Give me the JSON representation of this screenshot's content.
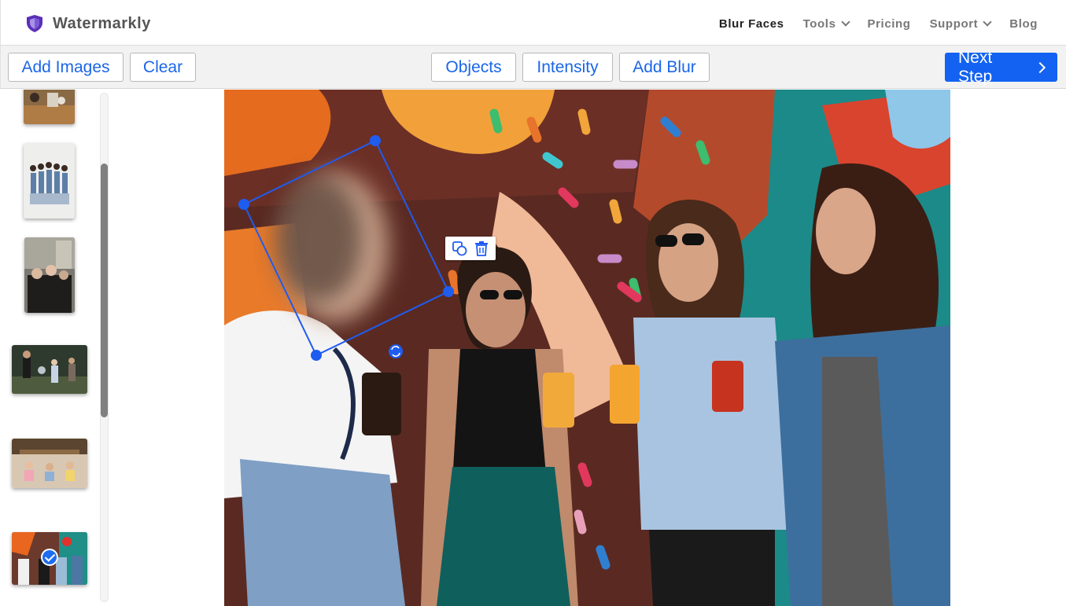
{
  "app": {
    "name": "Watermarkly",
    "brand_color": "#5b2fb8"
  },
  "nav": {
    "items": [
      {
        "label": "Blur Faces",
        "active": true,
        "dropdown": false
      },
      {
        "label": "Tools",
        "active": false,
        "dropdown": true
      },
      {
        "label": "Pricing",
        "active": false,
        "dropdown": false
      },
      {
        "label": "Support",
        "active": false,
        "dropdown": true
      },
      {
        "label": "Blog",
        "active": false,
        "dropdown": false
      }
    ]
  },
  "toolbar": {
    "add_images": "Add Images",
    "clear": "Clear",
    "objects": "Objects",
    "intensity": "Intensity",
    "add_blur": "Add Blur",
    "next_step": "Next Step",
    "accent": "#1362f1"
  },
  "sidebar": {
    "thumbnails": [
      {
        "name": "thumb-group-floor",
        "selected": false
      },
      {
        "name": "thumb-group-white-wall",
        "selected": false
      },
      {
        "name": "thumb-friends-street",
        "selected": false
      },
      {
        "name": "thumb-kids-park",
        "selected": false
      },
      {
        "name": "thumb-kids-sand",
        "selected": false
      },
      {
        "name": "thumb-mural-friends",
        "selected": true
      }
    ]
  },
  "editor": {
    "selection_color": "#1f5cf0",
    "actions": [
      "duplicate-icon",
      "trash-icon",
      "rotate-icon"
    ]
  }
}
